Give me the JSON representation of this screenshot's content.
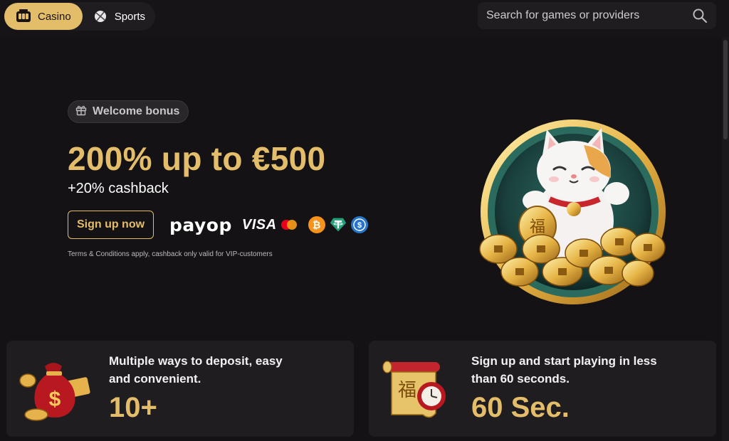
{
  "topbar": {
    "modes": [
      {
        "label": "Casino",
        "icon": "slot-machine-icon",
        "active": true
      },
      {
        "label": "Sports",
        "icon": "sports-ball-icon",
        "active": false
      }
    ],
    "search": {
      "placeholder": "Search for games or providers",
      "value": "",
      "icon": "search-icon"
    }
  },
  "hero": {
    "badge": {
      "label": "Welcome bonus",
      "icon": "gift-icon"
    },
    "headline": "200% up to €500",
    "subline": "+20% cashback",
    "cta": "Sign up now",
    "payments": {
      "payop": "payop",
      "visa": "VISA",
      "icons": [
        "mastercard-icon",
        "bitcoin-icon",
        "tether-icon",
        "usd-coin-icon"
      ]
    },
    "terms": "Terms & Conditions apply, cashback only valid for VIP-customers",
    "illustration": "lucky-cat-coins-illustration"
  },
  "features": [
    {
      "text": "Multiple ways to deposit, easy and convenient.",
      "line1": "Multiple ways to deposit, easy",
      "line2": "and convenient.",
      "value": "10+",
      "icon": "money-bag-icon"
    },
    {
      "text": "Sign up and start playing in less than 60 seconds.",
      "line1": "Sign up and start playing in less",
      "line2": "than 60 seconds.",
      "value": "60 Sec.",
      "icon": "scroll-clock-icon"
    }
  ],
  "colors": {
    "accent": "#e4bd6a",
    "background": "#141214",
    "surface": "#1f1d20"
  }
}
